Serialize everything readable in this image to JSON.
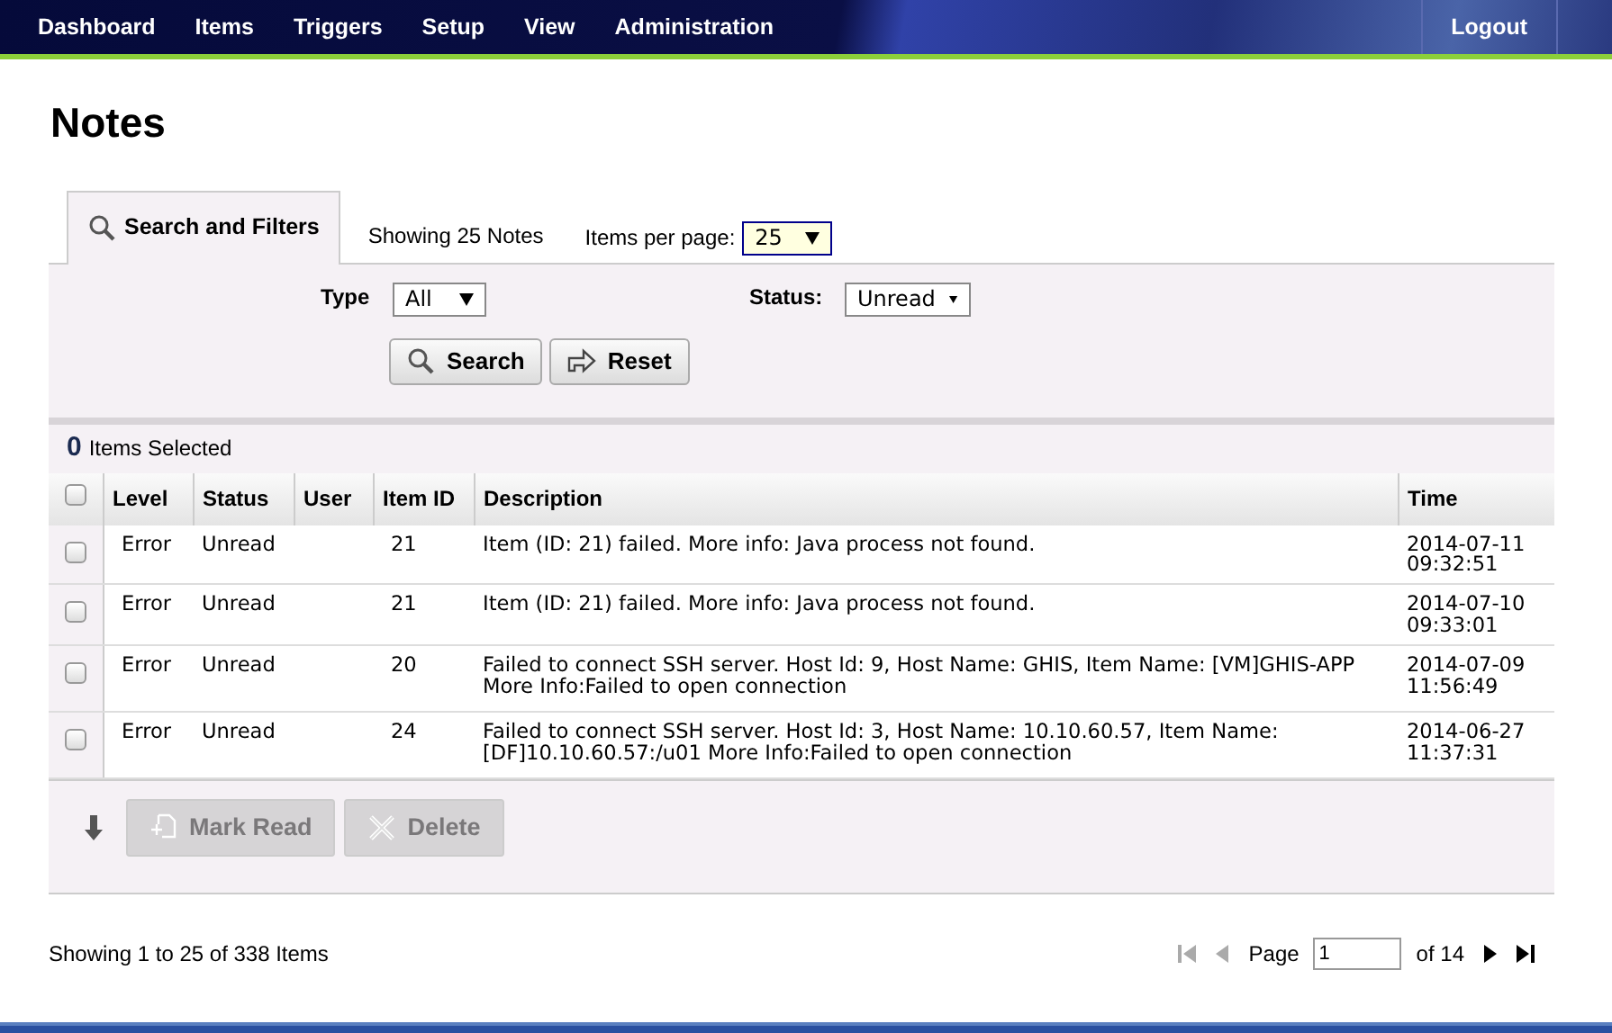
{
  "nav": {
    "items": [
      {
        "label": "Dashboard"
      },
      {
        "label": "Items"
      },
      {
        "label": "Triggers"
      },
      {
        "label": "Setup"
      },
      {
        "label": "View"
      },
      {
        "label": "Administration"
      }
    ],
    "logout": "Logout"
  },
  "title": "Notes",
  "tab": {
    "label": "Search and Filters",
    "selected": true
  },
  "showing": "Showing 25 Notes",
  "per_page": {
    "label": "Items per page:",
    "value": "25"
  },
  "filters": [
    {
      "label": "Type",
      "value": "All"
    },
    {
      "label": "Status:",
      "value": "Unread"
    }
  ],
  "buttons": [
    "Search",
    "Reset"
  ],
  "selected": {
    "count": "0",
    "label": "Items Selected"
  },
  "table": {
    "select_all": {
      "checked": false
    },
    "columns": [
      "Level",
      "Status",
      "User",
      "Item ID",
      "Description",
      "Time"
    ],
    "rows": [
      {
        "checked": false,
        "cells": [
          "Error",
          "Unread",
          "",
          "21",
          "Item (ID: 21) failed. More info: Java process not found.",
          "2014-07-11 09:32:51"
        ]
      },
      {
        "checked": false,
        "cells": [
          "Error",
          "Unread",
          "",
          "21",
          "Item (ID: 21) failed. More info: Java process not found.",
          "2014-07-10 09:33:01"
        ]
      },
      {
        "checked": false,
        "cells": [
          "Error",
          "Unread",
          "",
          "20",
          "Failed to connect SSH server. Host Id: 9, Host Name: GHIS, Item Name: [VM]GHIS-APP More Info:Failed to open connection",
          "2014-07-09 11:56:49"
        ]
      },
      {
        "checked": false,
        "cells": [
          "Error",
          "Unread",
          "",
          "24",
          "Failed to connect SSH server. Host Id: 3, Host Name: 10.10.60.57, Item Name: [DF]10.10.60.57:/u01 More Info:Failed to open connection",
          "2014-06-27 11:37:31"
        ]
      }
    ]
  },
  "actions": [
    {
      "label": "Mark Read",
      "disabled": true
    },
    {
      "label": "Delete",
      "disabled": true
    }
  ],
  "footer": {
    "summary": "Showing 1 to 25 of 338 Items",
    "page_label": "Page",
    "page": "1",
    "of": "of 14",
    "pager": [
      {
        "kind": "first",
        "disabled": true
      },
      {
        "kind": "prev",
        "disabled": true
      },
      {
        "kind": "next",
        "disabled": false
      },
      {
        "kind": "last",
        "disabled": false
      }
    ]
  }
}
